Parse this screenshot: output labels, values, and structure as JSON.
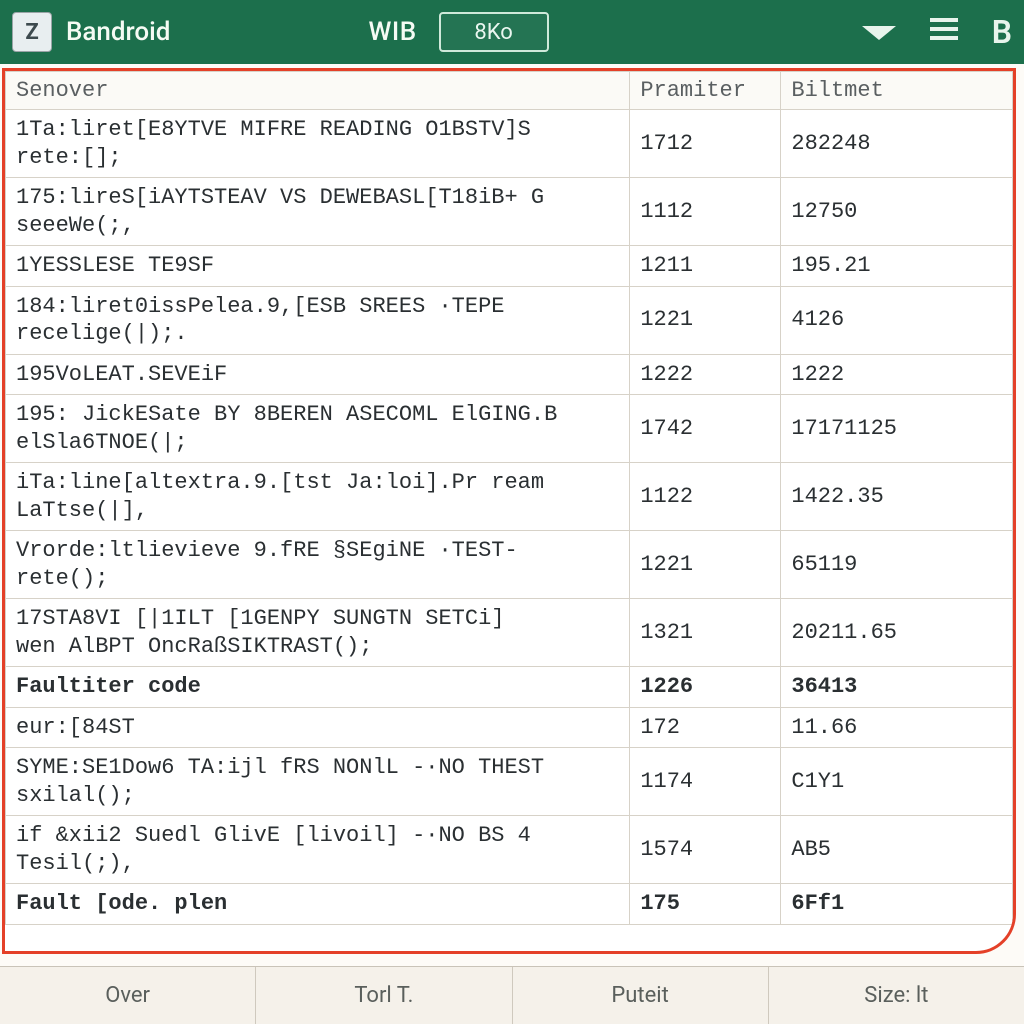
{
  "titlebar": {
    "icon_letter": "Z",
    "app_name": "Bandroid",
    "wib_label": "WIB",
    "field_value": "8Ko",
    "right_letter": "B"
  },
  "columns": {
    "senover": "Senover",
    "pramiter": "Pramiter",
    "biltmet": "Biltmet"
  },
  "rows": [
    {
      "senover": "1Ta:liret[E8YTVE MIFRE READING O1BSTV]S\nrete:[];",
      "pramiter": "1712",
      "biltmet": "282248",
      "weight": "normal"
    },
    {
      "senover": "175:lireS[iAYTSTEAV VS DEWEBASL[T18iB+ G\nseeeWe(;,",
      "pramiter": "1112",
      "biltmet": "12750",
      "weight": "normal"
    },
    {
      "senover": "1YESSLESE TE9SF",
      "pramiter": "1211",
      "biltmet": "195.21",
      "weight": "normal"
    },
    {
      "senover": "184:liret0issPelea.9,[ESB SREES ·TEPE\nrecelige(|);.",
      "pramiter": "1221",
      "biltmet": "4126",
      "weight": "normal"
    },
    {
      "senover": "195VoLEAT.SEVEiF",
      "pramiter": "1222",
      "biltmet": "1222",
      "weight": "normal"
    },
    {
      "senover": "195: JickESate BY 8BEREN ASECOML ElGING.B\nelSla6TNOE(|;",
      "pramiter": "1742",
      "biltmet": "17171125",
      "weight": "normal"
    },
    {
      "senover": "iTa:line[altextra.9.[tst Ja:loi].Pr ream\nLaTtse(|],",
      "pramiter": "1122",
      "biltmet": "1422.35",
      "weight": "normal"
    },
    {
      "senover": "Vrorde:ltlievieve 9.fRE §SEgiNE ·TEST-\nrete();",
      "pramiter": "1221",
      "biltmet": "65119",
      "weight": "normal"
    },
    {
      "senover": "17STA8VI [|1ILT [1GENPY SUNGTN SETCi]\nwen AlBPT OncRaßSIKTRAST();",
      "pramiter": "1321",
      "biltmet": "20211.65",
      "weight": "normal"
    },
    {
      "senover": "Faultiter code",
      "pramiter": "1226",
      "biltmet": "36413",
      "weight": "bold"
    },
    {
      "senover": "eur:[84ST",
      "pramiter": "172",
      "biltmet": "11.66",
      "weight": "normal"
    },
    {
      "senover": "SYME:SE1Dow6 TA:ijl fRS NONlL -·NO THEST\nsxilal();",
      "pramiter": "1174",
      "biltmet": "C1Y1",
      "weight": "normal"
    },
    {
      "senover": "if &xii2 Suedl GlivE [livoil] -·NO BS 4\nTesil(;),",
      "pramiter": "1574",
      "biltmet": "AB5",
      "weight": "normal"
    },
    {
      "senover": "Fault [ode. plen",
      "pramiter": "175",
      "biltmet": "6Ff1",
      "weight": "bold"
    }
  ],
  "tabs": {
    "0": "Over",
    "1": "Torl T.",
    "2": "Puteit",
    "3": "Size: lt"
  }
}
